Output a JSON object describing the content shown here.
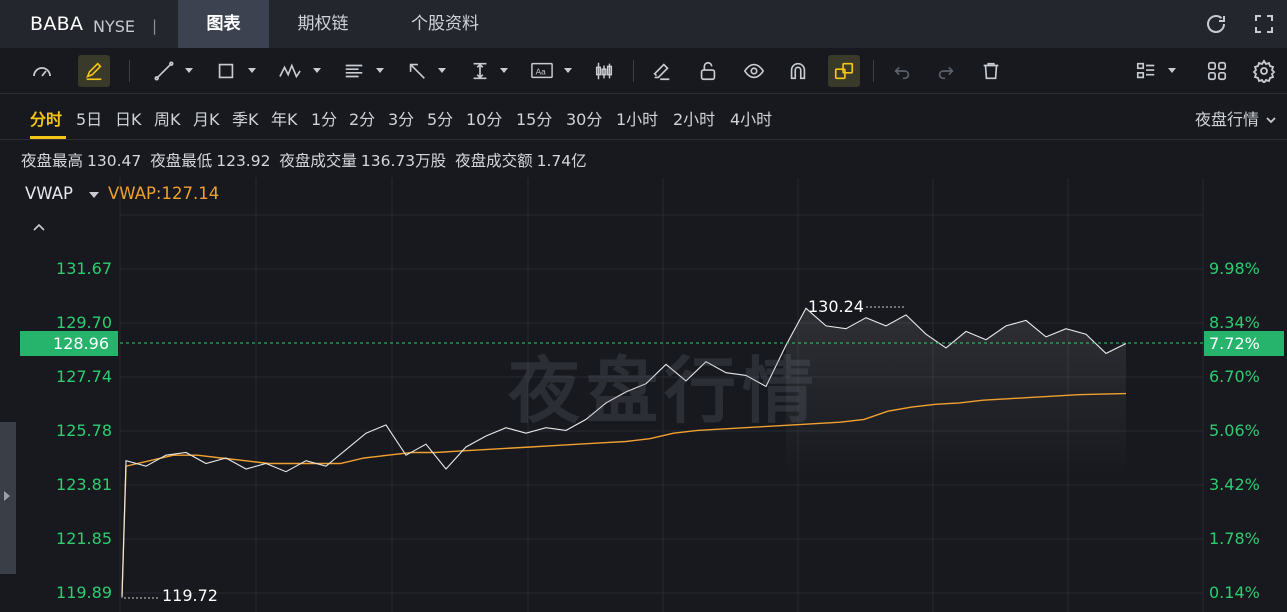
{
  "header": {
    "ticker": "BABA",
    "exchange": "NYSE",
    "separator": "|",
    "tabs": [
      {
        "label": "图表"
      },
      {
        "label": "期权链"
      },
      {
        "label": "个股资料"
      }
    ],
    "active_tab": "图表"
  },
  "toolbar": {
    "icons": [
      "gauge-icon",
      "pencil-draw-icon",
      "line-tool-icon",
      "rectangle-tool-icon",
      "pattern-tool-icon",
      "fib-tool-icon",
      "arrow-tool-icon",
      "measure-tool-icon",
      "text-tool-icon",
      "candle-tool-icon",
      "eraser-icon",
      "lock-icon",
      "eye-icon",
      "magnet-icon",
      "link-icon",
      "undo-icon",
      "redo-icon",
      "trash-icon",
      "layout-list-icon",
      "grid-icon",
      "settings-icon"
    ]
  },
  "periods": {
    "items": [
      "分时",
      "5日",
      "日K",
      "周K",
      "月K",
      "季K",
      "年K",
      "1分",
      "2分",
      "3分",
      "5分",
      "10分",
      "15分",
      "30分",
      "1小时",
      "2小时",
      "4小时"
    ],
    "active": "分时",
    "session_select": "夜盘行情"
  },
  "stats": {
    "high_label": "夜盘最高",
    "high_value": "130.47",
    "low_label": "夜盘最低",
    "low_value": "123.92",
    "volume_label": "夜盘成交量",
    "volume_value": "136.73万股",
    "turnover_label": "夜盘成交额",
    "turnover_value": "1.74亿"
  },
  "indicator": {
    "name": "VWAP",
    "value_text": "VWAP:127.14"
  },
  "chart": {
    "watermark": "夜盘行情",
    "current_price": "128.96",
    "current_pct": "7.72%",
    "high_marker": "130.24",
    "low_marker": "119.72",
    "y_left": [
      "131.67",
      "129.70",
      "127.74",
      "125.78",
      "123.81",
      "121.85",
      "119.89"
    ],
    "y_right": [
      "9.98%",
      "8.34%",
      "6.70%",
      "5.06%",
      "3.42%",
      "1.78%",
      "0.14%"
    ]
  },
  "colors": {
    "up": "#2ecc71",
    "price_line": "#e8e8e8",
    "vwap_line": "#f0a030",
    "accent": "#f5c518"
  },
  "chart_data": {
    "type": "line",
    "y_range": [
      119.72,
      132.2
    ],
    "series": [
      {
        "name": "VWAP",
        "y": [
          119.8,
          124.5,
          124.7,
          124.9,
          124.9,
          124.8,
          124.7,
          124.6,
          124.6,
          124.6,
          124.6,
          124.8,
          124.9,
          125.0,
          125.0,
          125.05,
          125.1,
          125.15,
          125.2,
          125.25,
          125.3,
          125.35,
          125.4,
          125.5,
          125.7,
          125.8,
          125.85,
          125.9,
          125.95,
          126.0,
          126.05,
          126.1,
          126.2,
          126.5,
          126.65,
          126.75,
          126.8,
          126.9,
          126.95,
          127.0,
          127.05,
          127.1,
          127.12,
          127.14
        ]
      },
      {
        "name": "",
        "y": [
          119.72,
          124.7,
          124.5,
          124.9,
          125.0,
          124.6,
          124.8,
          124.4,
          124.6,
          124.3,
          124.7,
          124.5,
          125.1,
          125.7,
          126.0,
          124.9,
          125.3,
          124.4,
          125.2,
          125.6,
          125.9,
          125.7,
          125.9,
          125.8,
          126.2,
          126.8,
          127.2,
          127.5,
          128.2,
          127.6,
          128.3,
          127.9,
          127.8,
          127.4,
          128.9,
          130.24,
          129.6,
          129.5,
          129.9,
          129.6,
          130.0,
          129.3,
          128.8,
          129.4,
          129.1,
          129.6,
          129.8,
          129.2,
          129.5,
          129.3,
          128.6,
          128.96
        ]
      }
    ]
  }
}
